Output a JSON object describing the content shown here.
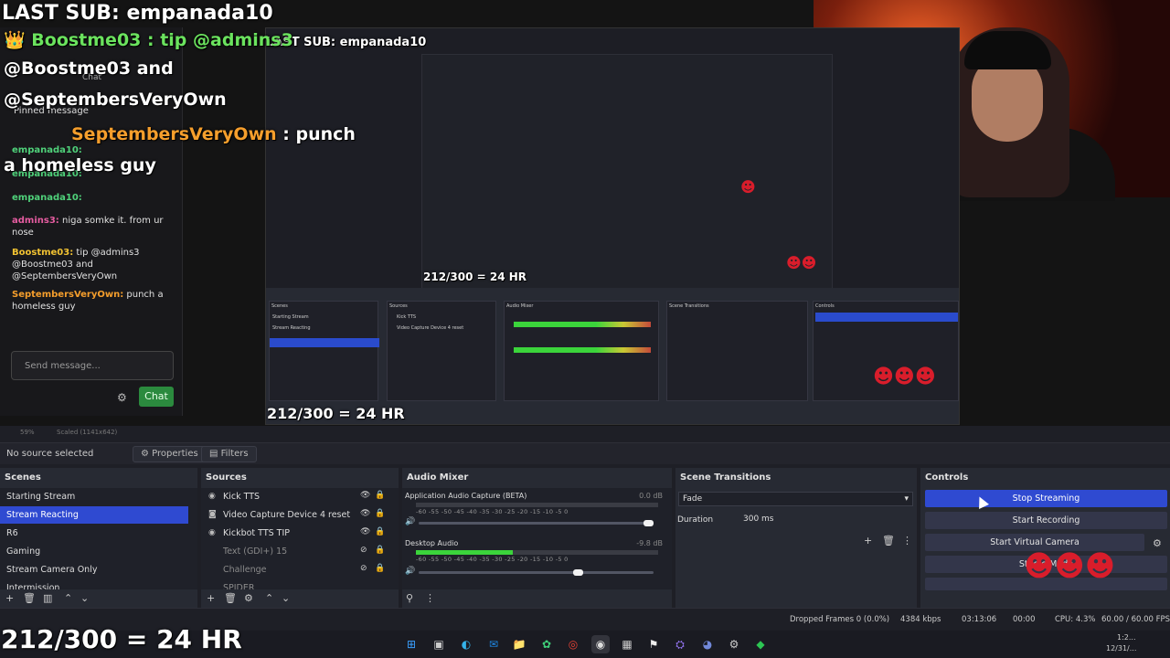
{
  "stream_overlay": {
    "last_sub": "LAST SUB: empanada10",
    "tip_line1": "Boostme03 : tip @admins3",
    "tip_line2": "@Boostme03 and",
    "tip_line3": "@SeptembersVeryOwn",
    "punch_user": "SeptembersVeryOwn",
    "punch_rest": " : punch",
    "punch_line2": "a homeless guy",
    "goal": "212/300 = 24 HR"
  },
  "chat": {
    "title": "Chat",
    "pinned": "Pinned message",
    "messages": [
      {
        "user": "empanada10:",
        "text": ""
      },
      {
        "user": "empanada10:",
        "text": ""
      },
      {
        "user": "empanada10:",
        "text": ""
      },
      {
        "user": "admins3:",
        "text": " niga somke it. from ur nose"
      },
      {
        "user": "Boostme03:",
        "text": " tip @admins3 @Boostme03 and @SeptembersVeryOwn"
      },
      {
        "user": "SeptembersVeryOwn:",
        "text": " punch a homeless guy"
      }
    ],
    "input_placeholder": "Send message...",
    "chat_button": "Chat"
  },
  "preview_scale": {
    "zoom": "59%",
    "scaled": "Scaled (1141x642)"
  },
  "context": {
    "no_source": "No source selected",
    "properties": "Properties",
    "filters": "Filters"
  },
  "scenes": {
    "title": "Scenes",
    "items": [
      "Starting Stream",
      "Stream Reacting",
      "R6",
      "Gaming",
      "Stream Camera Only",
      "Intermission"
    ],
    "selected_index": 1
  },
  "sources": {
    "title": "Sources",
    "items": [
      {
        "label": "Kick TTS",
        "dim": false
      },
      {
        "label": "Video Capture Device 4 reset",
        "dim": false
      },
      {
        "label": "Kickbot TTS TIP",
        "dim": false
      },
      {
        "label": "Text (GDI+) 15",
        "dim": true
      },
      {
        "label": "Challenge",
        "dim": true
      },
      {
        "label": "SPIDER",
        "dim": true
      }
    ]
  },
  "audio_mixer": {
    "title": "Audio Mixer",
    "channels": [
      {
        "name": "Application Audio Capture (BETA)",
        "db": "0.0 dB",
        "level": 0.0,
        "volume": 1.0
      },
      {
        "name": "Desktop Audio",
        "db": "-9.8 dB",
        "level": 0.4,
        "volume": 0.7
      }
    ],
    "scale": "-60  -55  -50  -45  -40  -35  -30  -25  -20  -15  -10  -5  0"
  },
  "transitions": {
    "title": "Scene Transitions",
    "selected": "Fade",
    "duration_label": "Duration",
    "duration_value": "300 ms"
  },
  "controls": {
    "title": "Controls",
    "stop_streaming": "Stop Streaming",
    "start_recording": "Start Recording",
    "start_virtual_camera": "Start Virtual Camera",
    "studio_mode": "Studio Mode"
  },
  "status": {
    "dropped": "Dropped Frames 0 (0.0%)",
    "bitrate": "4384 kbps",
    "live_time": "03:13:06",
    "rec_time": "00:00",
    "cpu": "CPU: 4.3%",
    "fps": "60.00 / 60.00 FPS"
  },
  "taskbar": {
    "time": "1:2...",
    "date": "12/31/..."
  }
}
